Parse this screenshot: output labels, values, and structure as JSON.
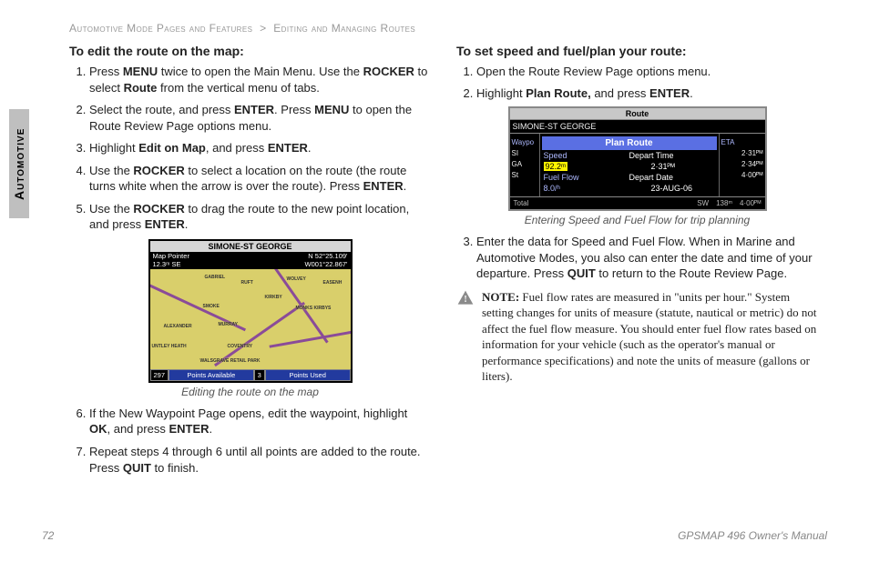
{
  "breadcrumb": {
    "section": "Automotive Mode Pages and Features",
    "sep": ">",
    "sub": "Editing and Managing Routes"
  },
  "side_tab": "Automotive",
  "left": {
    "heading": "To edit the route on the map:",
    "step1": {
      "pre": "Press ",
      "b1": "MENU",
      "mid1": " twice to open the Main Menu. Use the ",
      "b2": "ROCKER",
      "mid2": " to select ",
      "b3": "Route",
      "post": " from the vertical menu of tabs."
    },
    "step2": {
      "pre": "Select the route, and press ",
      "b1": "ENTER",
      "mid1": ". Press ",
      "b2": "MENU",
      "post": " to open the Route Review Page options menu."
    },
    "step3": {
      "pre": "Highlight ",
      "b1": "Edit on Map",
      "mid1": ", and press ",
      "b2": "ENTER",
      "post": "."
    },
    "step4": {
      "pre": "Use the ",
      "b1": "ROCKER",
      "mid1": " to select a location on the route (the route turns white when the arrow is over the route). Press ",
      "b2": "ENTER",
      "post": "."
    },
    "step5": {
      "pre": "Use the ",
      "b1": "ROCKER",
      "mid1": " to drag the route to the new point location, and press ",
      "b2": "ENTER",
      "post": "."
    },
    "step6": {
      "pre": "If the New Waypoint Page opens, edit the waypoint, highlight ",
      "b1": "OK",
      "mid1": ", and press ",
      "b2": "ENTER",
      "post": "."
    },
    "step7": {
      "pre": "Repeat steps 4 through 6 until all points are added to the route. Press ",
      "b1": "QUIT",
      "post": " to finish."
    },
    "figure1": {
      "caption": "Editing the route on the map",
      "title": "SIMONE-ST GEORGE",
      "sub_left": "Map Pointer\n12.3ᵐ  SE",
      "sub_right": "N  52°25.109'\nW001°22.867'",
      "foot_left_num": "297",
      "foot_left": "Points Available",
      "foot_right_num": "3",
      "foot_right": "Points Used",
      "labels": [
        "GABRIEL",
        "RUFT",
        "WOLVEY",
        "EASENH",
        "SMOKE",
        "KIRKBY",
        "ALEXANDER",
        "MURRAY",
        "UNTLEY HEATH",
        "COVENTRY",
        "WALSGRAVE RETAIL PARK",
        "MONKS KIRBYS"
      ]
    }
  },
  "right": {
    "heading": "To set speed and fuel/plan your route:",
    "step1": "Open the Route Review Page options menu.",
    "step2": {
      "pre": "Highlight ",
      "b1": "Plan Route,",
      "mid1": " and press ",
      "b2": "ENTER",
      "post": "."
    },
    "step3": {
      "pre": "Enter the data for Speed and Fuel Flow. When in Marine and Automotive Modes, you also can enter the date and time of your departure. Press ",
      "b1": "QUIT",
      "post": " to return to the Route Review Page."
    },
    "figure2": {
      "caption": "Entering Speed and Fuel Flow for trip planning",
      "header": "Route",
      "subtitle": "SIMONE-ST GEORGE",
      "leftcol_head": "Waypo",
      "leftcol": [
        "SI",
        "GA",
        "St"
      ],
      "dialog_title": "Plan Route",
      "rows": [
        {
          "k": "Speed",
          "v": "Depart Time"
        },
        {
          "k_hl": "92.2ᵐ",
          "v": "2·31ᴾᴹ"
        },
        {
          "k": "Fuel Flow",
          "v": "Depart Date"
        },
        {
          "k_hl2": "8.0/ʰ",
          "v": "23-AUG-06"
        }
      ],
      "rightcol_head": "ETA",
      "rightcol": [
        "2·31ᴾᴹ",
        "2·34ᴾᴹ",
        "4·00ᴾᴹ"
      ],
      "footer": {
        "total": "Total",
        "sw": "SW",
        "dist": "138ᵐ",
        "time": "4·00ᴾᴹ"
      }
    },
    "note_label": "NOTE:",
    "note_body": " Fuel flow rates are measured in \"units per hour.\" System setting changes for units of measure (statute, nautical or metric) do not affect the fuel flow measure. You should enter fuel flow rates based on information for your vehicle (such as the operator's manual or performance specifications) and note the units of measure (gallons or liters)."
  },
  "footer": {
    "page": "72",
    "manual": "GPSMAP 496 Owner's Manual"
  }
}
